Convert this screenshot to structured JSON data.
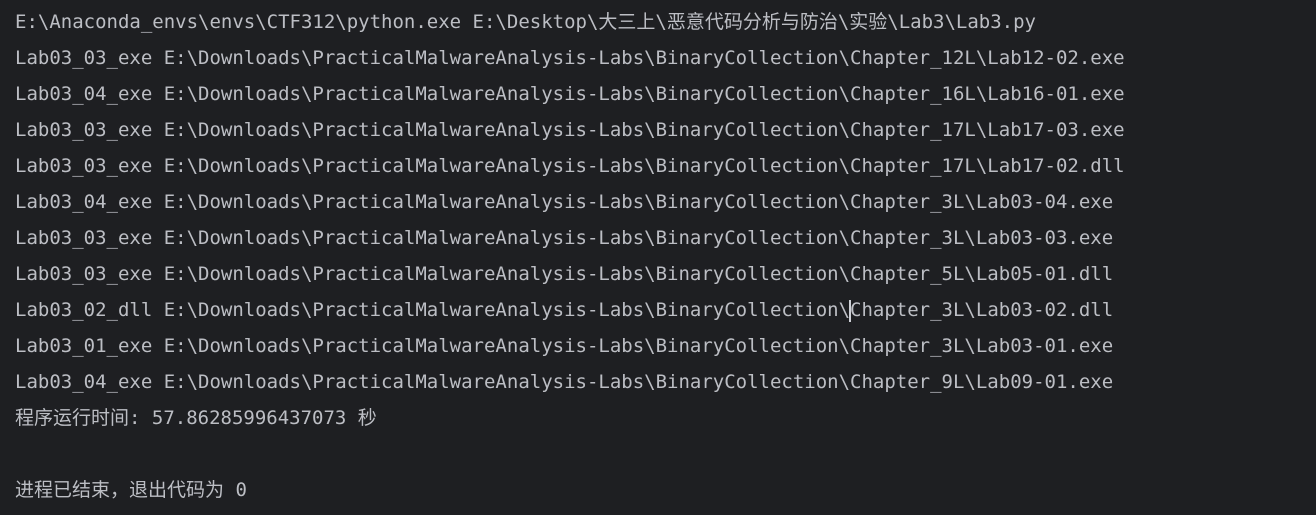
{
  "console": {
    "command": "E:\\Anaconda_envs\\envs\\CTF312\\python.exe E:\\Desktop\\大三上\\恶意代码分析与防治\\实验\\Lab3\\Lab3.py",
    "output_lines": [
      "Lab03_03_exe E:\\Downloads\\PracticalMalwareAnalysis-Labs\\BinaryCollection\\Chapter_12L\\Lab12-02.exe",
      "Lab03_04_exe E:\\Downloads\\PracticalMalwareAnalysis-Labs\\BinaryCollection\\Chapter_16L\\Lab16-01.exe",
      "Lab03_03_exe E:\\Downloads\\PracticalMalwareAnalysis-Labs\\BinaryCollection\\Chapter_17L\\Lab17-03.exe",
      "Lab03_03_exe E:\\Downloads\\PracticalMalwareAnalysis-Labs\\BinaryCollection\\Chapter_17L\\Lab17-02.dll",
      "Lab03_04_exe E:\\Downloads\\PracticalMalwareAnalysis-Labs\\BinaryCollection\\Chapter_3L\\Lab03-04.exe",
      "Lab03_03_exe E:\\Downloads\\PracticalMalwareAnalysis-Labs\\BinaryCollection\\Chapter_3L\\Lab03-03.exe",
      "Lab03_03_exe E:\\Downloads\\PracticalMalwareAnalysis-Labs\\BinaryCollection\\Chapter_5L\\Lab05-01.dll",
      "Lab03_02_dll E:\\Downloads\\PracticalMalwareAnalysis-Labs\\BinaryCollection\\",
      "Lab03_01_exe E:\\Downloads\\PracticalMalwareAnalysis-Labs\\BinaryCollection\\Chapter_3L\\Lab03-01.exe",
      "Lab03_04_exe E:\\Downloads\\PracticalMalwareAnalysis-Labs\\BinaryCollection\\Chapter_9L\\Lab09-01.exe"
    ],
    "caret_line_tail": "Chapter_3L\\Lab03-02.dll",
    "runtime": "程序运行时间: 57.86285996437073 秒",
    "exit_message": "进程已结束，退出代码为 0"
  }
}
